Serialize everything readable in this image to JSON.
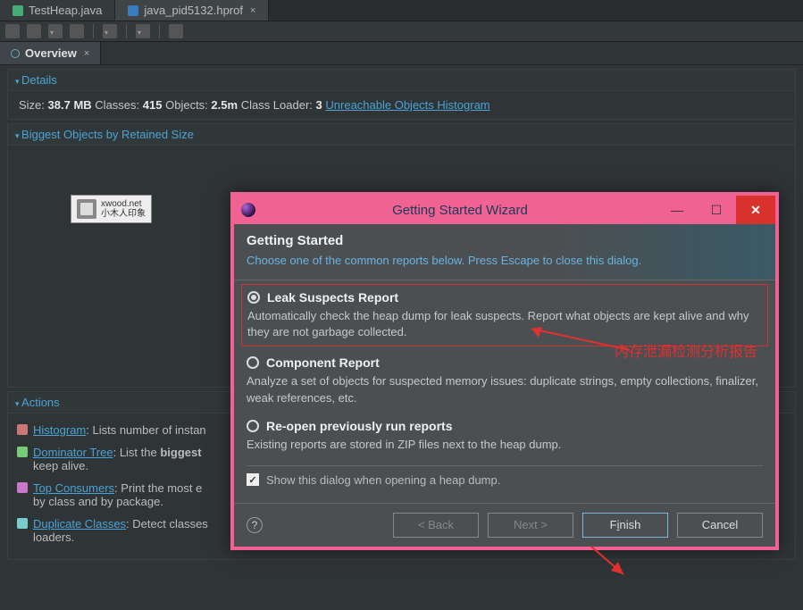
{
  "filetabs": [
    {
      "label": "TestHeap.java",
      "type": "java",
      "active": false
    },
    {
      "label": "java_pid5132.hprof",
      "type": "hprof",
      "active": true
    }
  ],
  "subtab": {
    "label": "Overview"
  },
  "details": {
    "header": "Details",
    "size_label": "Size:",
    "size_value": "38.7 MB",
    "classes_label": "Classes:",
    "classes_value": "415",
    "objects_label": "Objects:",
    "objects_value": "2.5m",
    "loader_label": "Class Loader:",
    "loader_value": "3",
    "unreachable_link": "Unreachable Objects Histogram"
  },
  "biggest_header": "Biggest Objects by Retained Size",
  "watermark": {
    "line1": "xwood.net",
    "line2": "小木人印象"
  },
  "actions_header": "Actions",
  "actions": {
    "histogram": {
      "link": "Histogram",
      "desc": ": Lists number of instan"
    },
    "dominator": {
      "link": "Dominator Tree",
      "desc1": ": List the ",
      "bold": "biggest",
      "desc2": " keep alive."
    },
    "top": {
      "link": "Top Consumers",
      "desc": ": Print the most e",
      "desc2": "by class and by package."
    },
    "dup": {
      "link": "Duplicate Classes",
      "desc": ": Detect classes ",
      "desc2": "loaders."
    }
  },
  "dialog": {
    "title": "Getting Started Wizard",
    "heading": "Getting Started",
    "sub": "Choose one of the common reports below. Press Escape to close this dialog.",
    "options": [
      {
        "label": "Leak Suspects Report",
        "desc": "Automatically check the heap dump for leak suspects. Report what objects are kept alive and why they are not garbage collected.",
        "selected": true
      },
      {
        "label": "Component Report",
        "desc": "Analyze a set of objects for suspected memory issues: duplicate strings, empty collections, finalizer, weak references, etc.",
        "selected": false
      },
      {
        "label": "Re-open previously run reports",
        "desc": "Existing reports are stored in ZIP files next to the heap dump.",
        "selected": false
      }
    ],
    "checkbox_label": "Show this dialog when opening a heap dump.",
    "checkbox_checked": true,
    "buttons": {
      "back": "< Back",
      "next": "Next >",
      "finish_pre": "F",
      "finish_mn": "i",
      "finish_post": "nish",
      "cancel": "Cancel"
    }
  },
  "annotation": "内存泄漏检测分析报告"
}
